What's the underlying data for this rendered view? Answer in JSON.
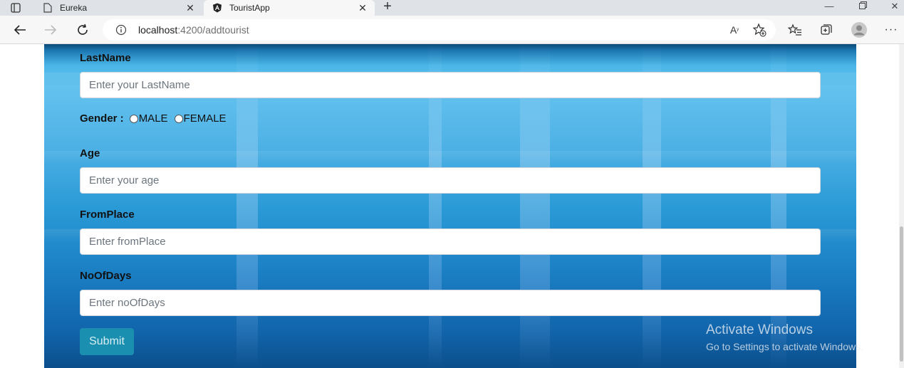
{
  "browser": {
    "tabs": [
      {
        "title": "Eureka",
        "active": false,
        "icon": "page-icon"
      },
      {
        "title": "TouristApp",
        "active": true,
        "icon": "angular-icon"
      }
    ],
    "address": {
      "host": "localhost",
      "path": ":4200/addtourist"
    }
  },
  "form": {
    "lastname": {
      "label": "LastName",
      "placeholder": "Enter your LastName"
    },
    "gender": {
      "label": "Gender :",
      "options": [
        "MALE",
        "FEMALE"
      ]
    },
    "age": {
      "label": "Age",
      "placeholder": "Enter your age"
    },
    "fromplace": {
      "label": "FromPlace",
      "placeholder": "Enter fromPlace"
    },
    "noofdays": {
      "label": "NoOfDays",
      "placeholder": "Enter noOfDays"
    },
    "submit_label": "Submit"
  },
  "watermark": {
    "title": "Activate Windows",
    "subtitle": "Go to Settings to activate Windows."
  },
  "colors": {
    "accent": "#1a8fb0",
    "water": "#2a9ad6"
  }
}
